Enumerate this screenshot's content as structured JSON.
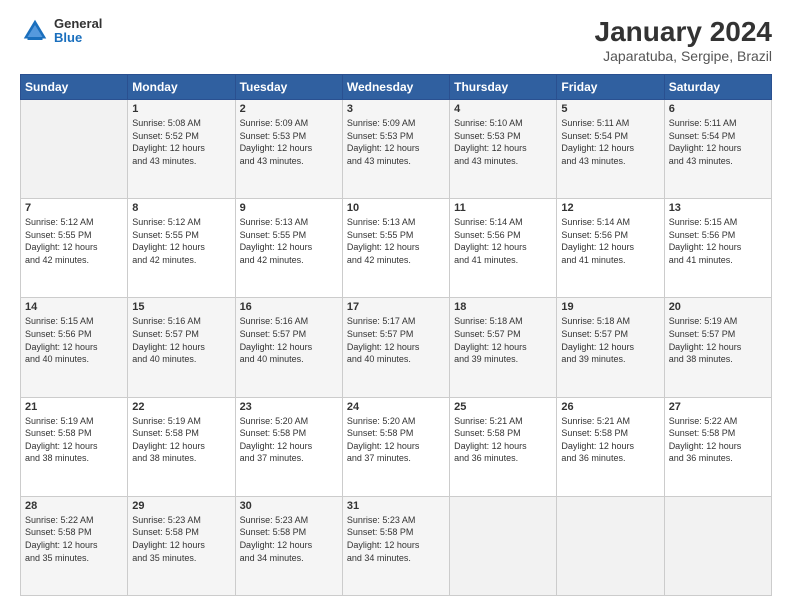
{
  "header": {
    "logo": {
      "general": "General",
      "blue": "Blue"
    },
    "title": "January 2024",
    "location": "Japaratuba, Sergipe, Brazil"
  },
  "weekdays": [
    "Sunday",
    "Monday",
    "Tuesday",
    "Wednesday",
    "Thursday",
    "Friday",
    "Saturday"
  ],
  "weeks": [
    [
      {
        "day": "",
        "info": ""
      },
      {
        "day": "1",
        "info": "Sunrise: 5:08 AM\nSunset: 5:52 PM\nDaylight: 12 hours\nand 43 minutes."
      },
      {
        "day": "2",
        "info": "Sunrise: 5:09 AM\nSunset: 5:53 PM\nDaylight: 12 hours\nand 43 minutes."
      },
      {
        "day": "3",
        "info": "Sunrise: 5:09 AM\nSunset: 5:53 PM\nDaylight: 12 hours\nand 43 minutes."
      },
      {
        "day": "4",
        "info": "Sunrise: 5:10 AM\nSunset: 5:53 PM\nDaylight: 12 hours\nand 43 minutes."
      },
      {
        "day": "5",
        "info": "Sunrise: 5:11 AM\nSunset: 5:54 PM\nDaylight: 12 hours\nand 43 minutes."
      },
      {
        "day": "6",
        "info": "Sunrise: 5:11 AM\nSunset: 5:54 PM\nDaylight: 12 hours\nand 43 minutes."
      }
    ],
    [
      {
        "day": "7",
        "info": "Sunrise: 5:12 AM\nSunset: 5:55 PM\nDaylight: 12 hours\nand 42 minutes."
      },
      {
        "day": "8",
        "info": "Sunrise: 5:12 AM\nSunset: 5:55 PM\nDaylight: 12 hours\nand 42 minutes."
      },
      {
        "day": "9",
        "info": "Sunrise: 5:13 AM\nSunset: 5:55 PM\nDaylight: 12 hours\nand 42 minutes."
      },
      {
        "day": "10",
        "info": "Sunrise: 5:13 AM\nSunset: 5:55 PM\nDaylight: 12 hours\nand 42 minutes."
      },
      {
        "day": "11",
        "info": "Sunrise: 5:14 AM\nSunset: 5:56 PM\nDaylight: 12 hours\nand 41 minutes."
      },
      {
        "day": "12",
        "info": "Sunrise: 5:14 AM\nSunset: 5:56 PM\nDaylight: 12 hours\nand 41 minutes."
      },
      {
        "day": "13",
        "info": "Sunrise: 5:15 AM\nSunset: 5:56 PM\nDaylight: 12 hours\nand 41 minutes."
      }
    ],
    [
      {
        "day": "14",
        "info": "Sunrise: 5:15 AM\nSunset: 5:56 PM\nDaylight: 12 hours\nand 40 minutes."
      },
      {
        "day": "15",
        "info": "Sunrise: 5:16 AM\nSunset: 5:57 PM\nDaylight: 12 hours\nand 40 minutes."
      },
      {
        "day": "16",
        "info": "Sunrise: 5:16 AM\nSunset: 5:57 PM\nDaylight: 12 hours\nand 40 minutes."
      },
      {
        "day": "17",
        "info": "Sunrise: 5:17 AM\nSunset: 5:57 PM\nDaylight: 12 hours\nand 40 minutes."
      },
      {
        "day": "18",
        "info": "Sunrise: 5:18 AM\nSunset: 5:57 PM\nDaylight: 12 hours\nand 39 minutes."
      },
      {
        "day": "19",
        "info": "Sunrise: 5:18 AM\nSunset: 5:57 PM\nDaylight: 12 hours\nand 39 minutes."
      },
      {
        "day": "20",
        "info": "Sunrise: 5:19 AM\nSunset: 5:57 PM\nDaylight: 12 hours\nand 38 minutes."
      }
    ],
    [
      {
        "day": "21",
        "info": "Sunrise: 5:19 AM\nSunset: 5:58 PM\nDaylight: 12 hours\nand 38 minutes."
      },
      {
        "day": "22",
        "info": "Sunrise: 5:19 AM\nSunset: 5:58 PM\nDaylight: 12 hours\nand 38 minutes."
      },
      {
        "day": "23",
        "info": "Sunrise: 5:20 AM\nSunset: 5:58 PM\nDaylight: 12 hours\nand 37 minutes."
      },
      {
        "day": "24",
        "info": "Sunrise: 5:20 AM\nSunset: 5:58 PM\nDaylight: 12 hours\nand 37 minutes."
      },
      {
        "day": "25",
        "info": "Sunrise: 5:21 AM\nSunset: 5:58 PM\nDaylight: 12 hours\nand 36 minutes."
      },
      {
        "day": "26",
        "info": "Sunrise: 5:21 AM\nSunset: 5:58 PM\nDaylight: 12 hours\nand 36 minutes."
      },
      {
        "day": "27",
        "info": "Sunrise: 5:22 AM\nSunset: 5:58 PM\nDaylight: 12 hours\nand 36 minutes."
      }
    ],
    [
      {
        "day": "28",
        "info": "Sunrise: 5:22 AM\nSunset: 5:58 PM\nDaylight: 12 hours\nand 35 minutes."
      },
      {
        "day": "29",
        "info": "Sunrise: 5:23 AM\nSunset: 5:58 PM\nDaylight: 12 hours\nand 35 minutes."
      },
      {
        "day": "30",
        "info": "Sunrise: 5:23 AM\nSunset: 5:58 PM\nDaylight: 12 hours\nand 34 minutes."
      },
      {
        "day": "31",
        "info": "Sunrise: 5:23 AM\nSunset: 5:58 PM\nDaylight: 12 hours\nand 34 minutes."
      },
      {
        "day": "",
        "info": ""
      },
      {
        "day": "",
        "info": ""
      },
      {
        "day": "",
        "info": ""
      }
    ]
  ]
}
